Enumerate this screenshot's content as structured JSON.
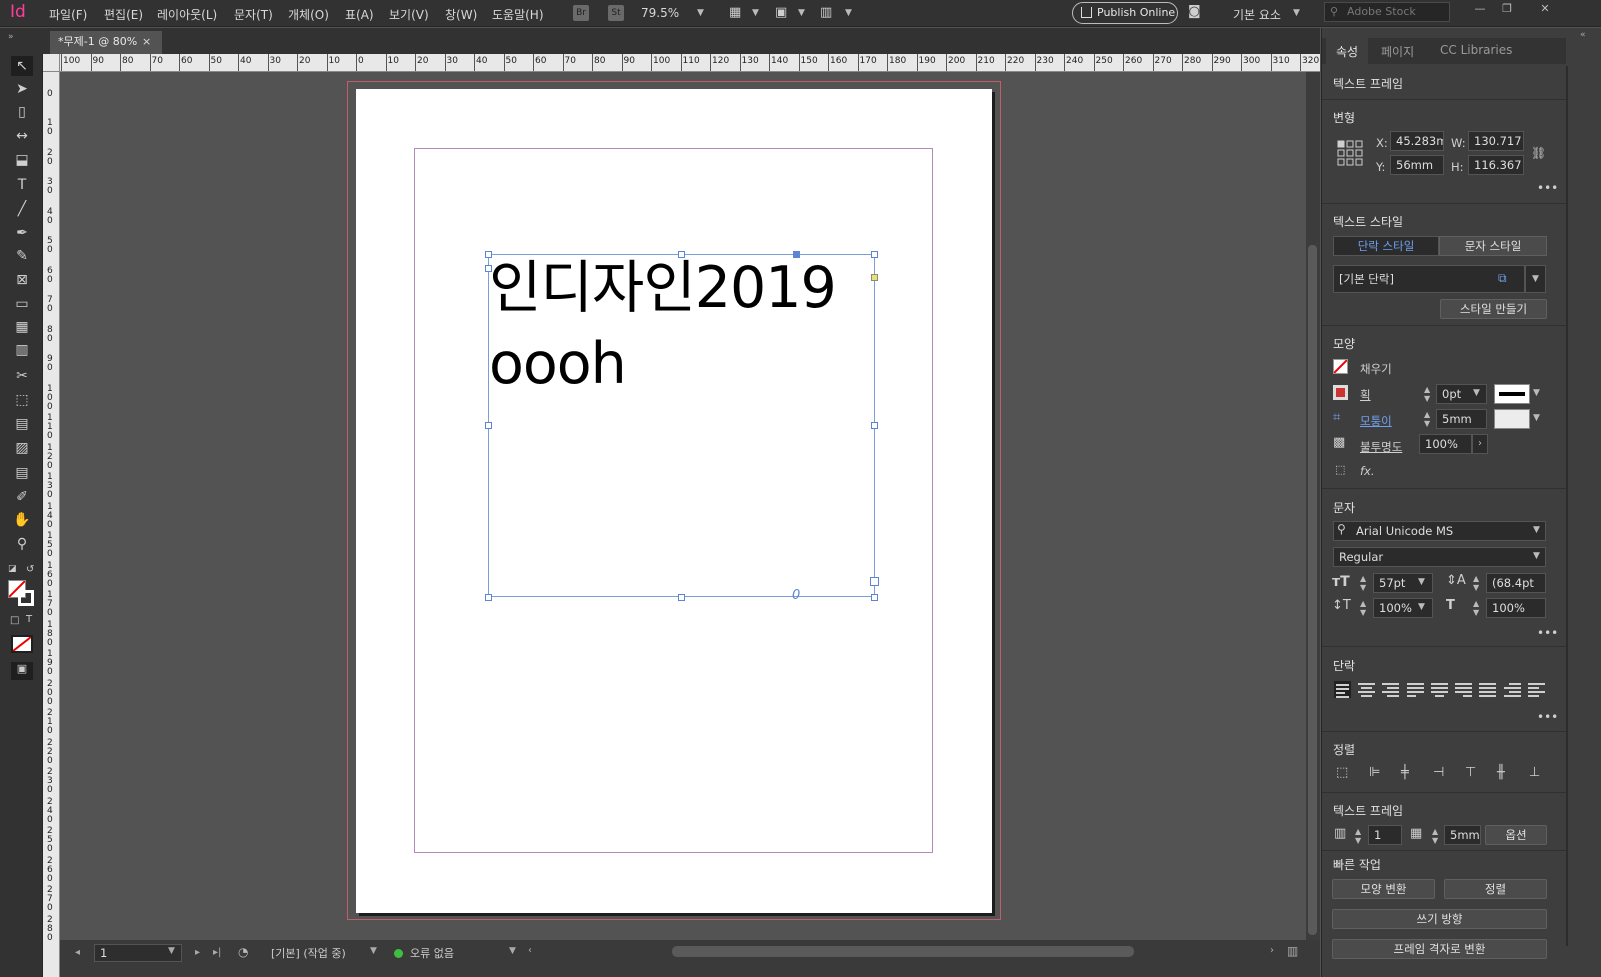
{
  "app": {
    "logo": "Id"
  },
  "menu": [
    "파일(F)",
    "편집(E)",
    "레이아웃(L)",
    "문자(T)",
    "개체(O)",
    "표(A)",
    "보기(V)",
    "창(W)",
    "도움말(H)"
  ],
  "toolbar": {
    "br": "Br",
    "st": "St",
    "zoom": "79.5%",
    "publish": "Publish Online",
    "workspace": "기본 요소",
    "search_placeholder": "Adobe Stock"
  },
  "document": {
    "tab_title": "*무제-1 @ 80%",
    "close": "×"
  },
  "rulers": {
    "horizontal": [
      "100",
      "90",
      "80",
      "70",
      "60",
      "50",
      "40",
      "30",
      "20",
      "10",
      "0",
      "10",
      "20",
      "30",
      "40",
      "50",
      "60",
      "70",
      "80",
      "90",
      "100",
      "110",
      "120",
      "130",
      "140",
      "150",
      "160",
      "170",
      "180",
      "190",
      "200",
      "210",
      "220",
      "230",
      "240",
      "250",
      "260",
      "270",
      "280",
      "290",
      "300",
      "310",
      "320"
    ],
    "vertical": [
      "0",
      "0",
      "1 0",
      "2 0",
      "3 0",
      "4 0",
      "5 0",
      "6 0",
      "7 0",
      "8 0",
      "9 0",
      "1 0 0",
      "1 1 0",
      "1 2 0",
      "1 3 0",
      "1 4 0",
      "1 5 0",
      "1 6 0",
      "1 7 0",
      "1 8 0",
      "1 9 0",
      "2 0 0",
      "2 1 0",
      "2 2 0",
      "2 3 0",
      "2 4 0",
      "2 5 0",
      "2 6 0",
      "2 7 0",
      "2 8 0"
    ]
  },
  "frame": {
    "line1": "인디자인2019",
    "line2": "oooh"
  },
  "status": {
    "page": "1",
    "style": "[기본] (작업 중)",
    "errors": "오류 없음"
  },
  "panel": {
    "tabs": [
      "속성",
      "페이지",
      "CC Libraries"
    ],
    "object_type": "텍스트 프레임",
    "transform": {
      "title": "변형",
      "x_label": "X:",
      "x": "45.283m",
      "y_label": "Y:",
      "y": "56mm",
      "w_label": "W:",
      "w": "130.717",
      "h_label": "H:",
      "h": "116.367"
    },
    "text_style": {
      "title": "텍스트 스타일",
      "para_tab": "단락 스타일",
      "char_tab": "문자 스타일",
      "current": "[기본 단락]",
      "make_style": "스타일 만들기"
    },
    "appearance": {
      "title": "모양",
      "fill": "채우기",
      "stroke": "획",
      "stroke_val": "0pt",
      "corner": "모퉁이",
      "corner_val": "5mm",
      "opacity": "불투명도",
      "opacity_val": "100%",
      "fx": "fx."
    },
    "character": {
      "title": "문자",
      "font": "Arial Unicode MS",
      "style": "Regular",
      "size": "57pt",
      "leading": "(68.4pt",
      "vscale": "100%",
      "hscale": "100%"
    },
    "paragraph": {
      "title": "단락"
    },
    "align": {
      "title": "정렬"
    },
    "text_frame": {
      "title": "텍스트 프레임",
      "columns": "1",
      "gutter": "5mm",
      "options": "옵션"
    },
    "quick": {
      "title": "빠른 작업",
      "b1": "모양 변환",
      "b2": "정렬",
      "b3": "쓰기 방향",
      "b4": "프레임 격자로 변환"
    }
  },
  "colors": {
    "accent": "#5c86d1",
    "logo": "#ff3d9a",
    "bleed": "#c45c6a",
    "margin": "#b48ab8"
  }
}
